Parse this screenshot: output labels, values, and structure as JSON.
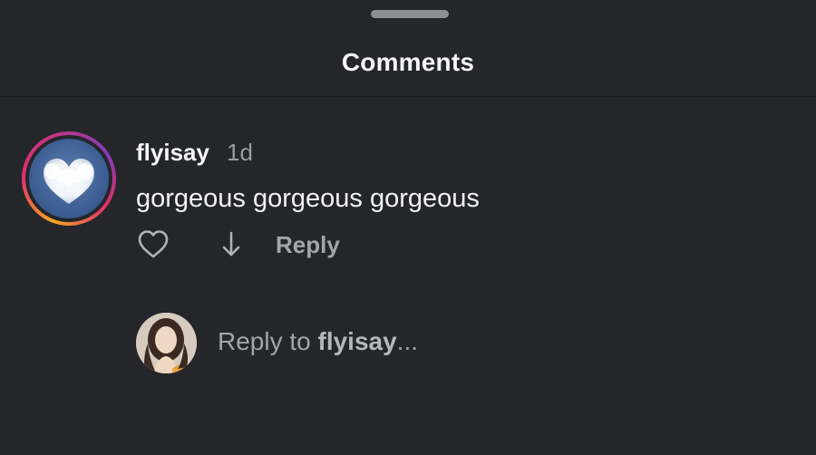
{
  "sheet": {
    "title": "Comments"
  },
  "comment": {
    "username": "flyisay",
    "time": "1d",
    "text": "gorgeous gorgeous gorgeous",
    "actions": {
      "like_icon": "heart-outline-icon",
      "sort_icon": "arrow-down-icon",
      "reply_label": "Reply"
    }
  },
  "composer": {
    "prompt_prefix": "Reply to ",
    "mention": "flyisay",
    "prompt_suffix": "..."
  },
  "colors": {
    "background": "#24262a",
    "primary_text": "#f5f5f5",
    "secondary_text": "#a3a5a9",
    "story_ring_start": "#f5a623",
    "story_ring_end": "#c13584"
  }
}
